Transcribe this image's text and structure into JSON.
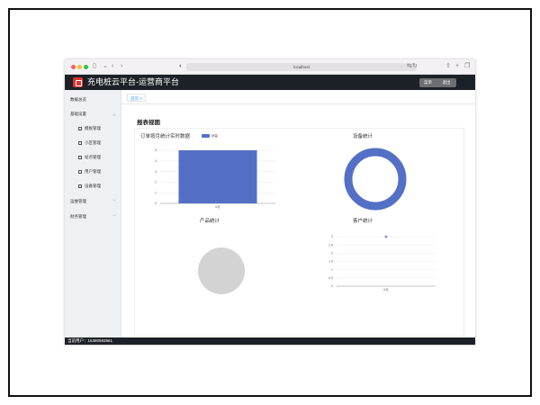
{
  "browser": {
    "url": "localhost"
  },
  "app": {
    "title": "充电桩云平台-运营商平台",
    "menu_button": "菜单",
    "exit_button": "退出"
  },
  "sidebar": {
    "items": [
      {
        "label": "数据总览"
      },
      {
        "label": "基础设置"
      },
      {
        "label": "模板管理"
      },
      {
        "label": "小区管理"
      },
      {
        "label": "站点管理"
      },
      {
        "label": "用户管理"
      },
      {
        "label": "设备管理"
      },
      {
        "label": "运维管理"
      },
      {
        "label": "财务管理"
      }
    ]
  },
  "tabs": [
    {
      "label": "首页 ×"
    }
  ],
  "page_title": "报表视图",
  "charts": {
    "orders": {
      "title": "订单按月统计实时数据",
      "legend": "销量"
    },
    "devices": {
      "title": "设备统计"
    },
    "products": {
      "title": "产品统计"
    },
    "customers": {
      "title": "客户统计"
    }
  },
  "status": {
    "current_user": "当前用户：15380593861"
  },
  "colors": {
    "series": "#5470c6",
    "appbar": "#1c2127",
    "pie_empty": "#d3d3d3"
  },
  "chart_data": [
    {
      "type": "bar",
      "title": "订单按月统计实时数据",
      "categories": [
        "6月"
      ],
      "series": [
        {
          "name": "销量",
          "values": [
            5
          ]
        }
      ],
      "yticks": [
        0,
        1,
        2,
        3,
        4,
        5
      ],
      "ylim": [
        0,
        5
      ]
    },
    {
      "type": "pie",
      "title": "设备统计",
      "variant": "donut",
      "slices": [
        {
          "value": 1
        }
      ]
    },
    {
      "type": "pie",
      "title": "产品统计",
      "slices": []
    },
    {
      "type": "line",
      "title": "客户统计",
      "categories": [
        "6月"
      ],
      "series": [
        {
          "values": [
            3
          ]
        }
      ],
      "yticks": [
        0,
        0.5,
        1,
        1.5,
        2,
        2.5,
        3
      ],
      "ylim": [
        0,
        3
      ]
    }
  ]
}
